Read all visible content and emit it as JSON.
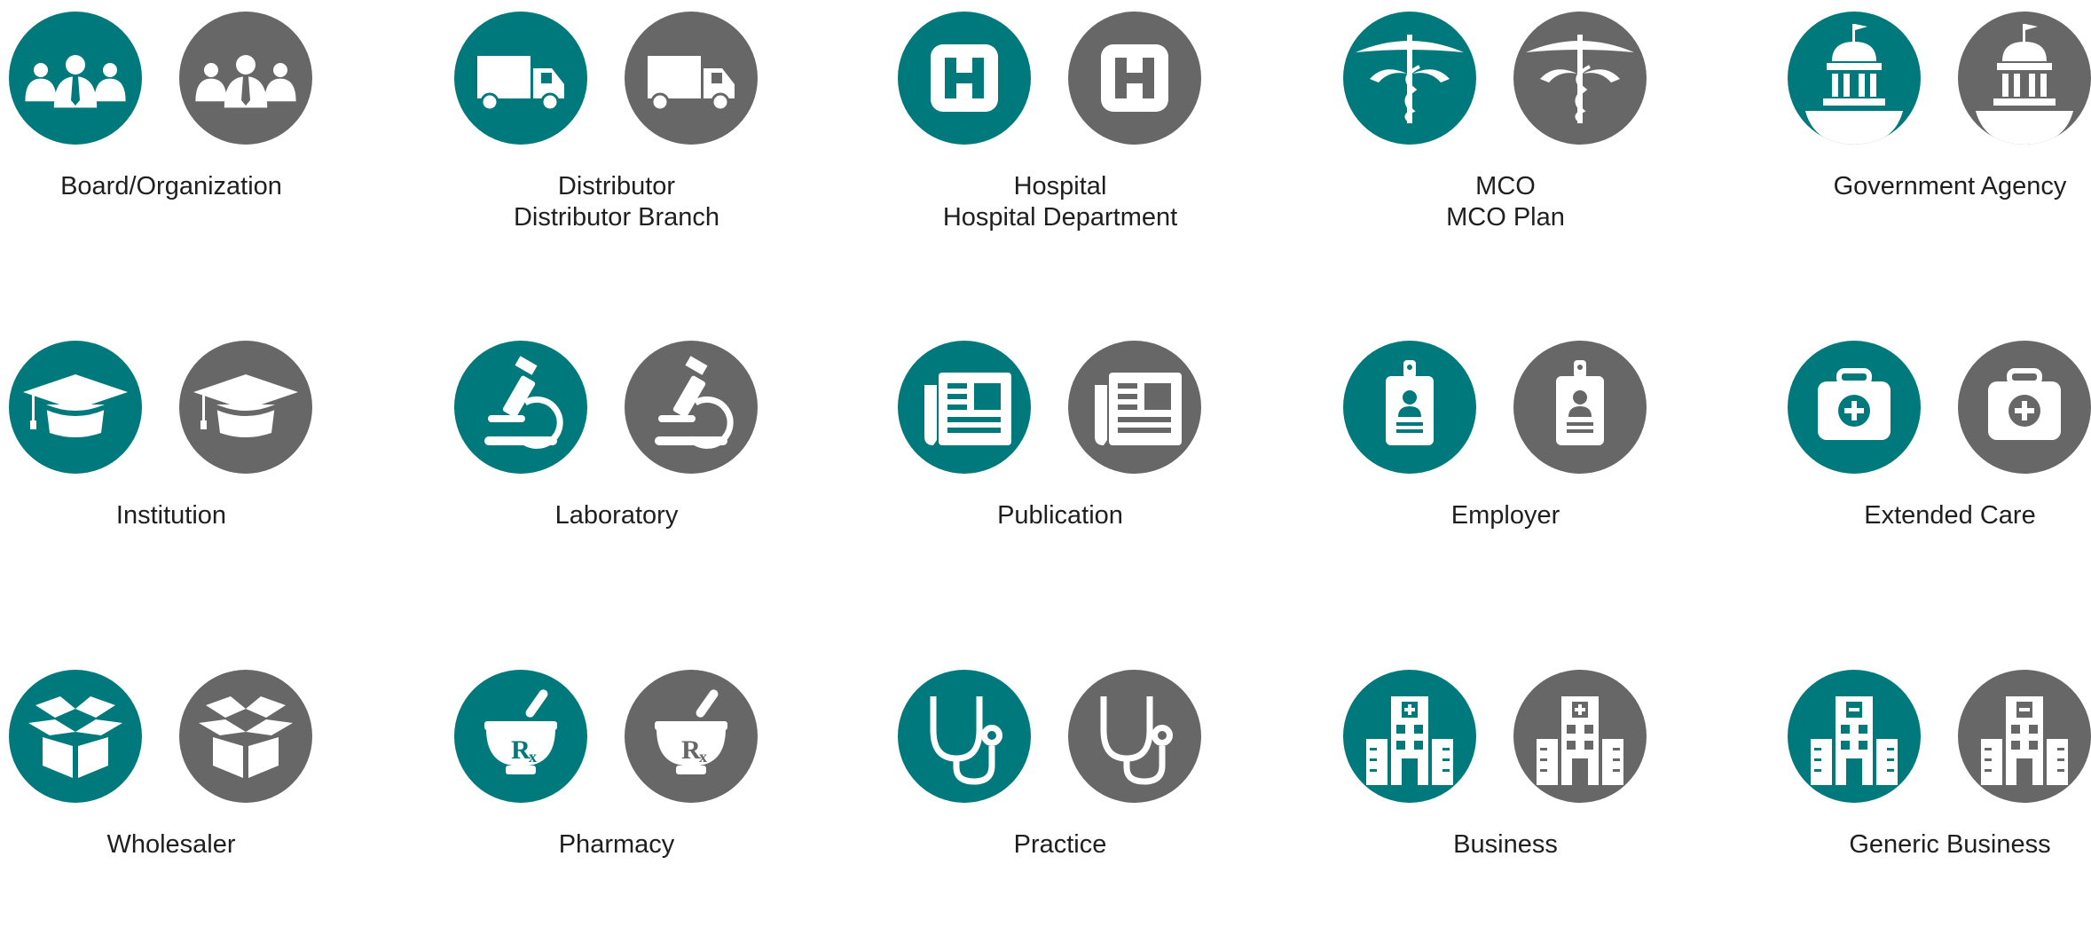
{
  "colors": {
    "teal": "#00797c",
    "gray": "#676767",
    "icon": "#ffffff",
    "text": "#1f1f1f"
  },
  "items": [
    {
      "icon": "people-icon",
      "lines": [
        "Board/Organization"
      ]
    },
    {
      "icon": "truck-icon",
      "lines": [
        "Distributor",
        "Distributor Branch"
      ]
    },
    {
      "icon": "hospital-h-icon",
      "lines": [
        "Hospital",
        "Hospital Department"
      ]
    },
    {
      "icon": "caduceus-icon",
      "lines": [
        "MCO",
        "MCO Plan"
      ]
    },
    {
      "icon": "government-building-icon",
      "lines": [
        "Government Agency"
      ]
    },
    {
      "icon": "graduation-cap-icon",
      "lines": [
        "Institution"
      ]
    },
    {
      "icon": "microscope-icon",
      "lines": [
        "Laboratory"
      ]
    },
    {
      "icon": "newspaper-icon",
      "lines": [
        "Publication"
      ]
    },
    {
      "icon": "id-badge-icon",
      "lines": [
        "Employer"
      ]
    },
    {
      "icon": "medical-kit-icon",
      "lines": [
        "Extended Care"
      ]
    },
    {
      "icon": "open-box-icon",
      "lines": [
        "Wholesaler"
      ]
    },
    {
      "icon": "mortar-pestle-rx-icon",
      "lines": [
        "Pharmacy"
      ]
    },
    {
      "icon": "stethoscope-icon",
      "lines": [
        "Practice"
      ]
    },
    {
      "icon": "office-buildings-plus-icon",
      "lines": [
        "Business"
      ]
    },
    {
      "icon": "office-buildings-minus-icon",
      "lines": [
        "Generic Business"
      ]
    }
  ]
}
